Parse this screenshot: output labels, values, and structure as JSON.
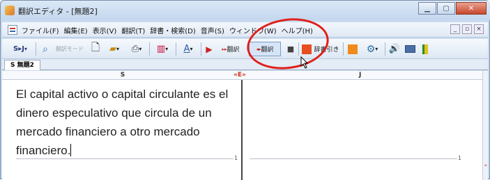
{
  "window": {
    "title": "翻訳エディタ - [無題2]",
    "controls": [
      "minimize-icon",
      "maximize-icon",
      "close-icon"
    ]
  },
  "menubar": {
    "items": [
      "ファイル(F)",
      "編集(E)",
      "表示(V)",
      "翻訳(T)",
      "辞書・検索(D)",
      "音声(S)",
      "ウィンドウ(W)",
      "ヘルプ(H)"
    ],
    "mdi_controls": [
      "_",
      "▫",
      "×"
    ]
  },
  "toolbar": {
    "lang_selector": "S▸J",
    "search_mode": "翻訳モード",
    "translate_label": "翻訳",
    "translate_back_label": "翻訳",
    "dict_lookup_label": "辞書引き"
  },
  "tab": {
    "label": "S 無題2"
  },
  "editor": {
    "left_header": "S",
    "mid_marker": "«E»",
    "right_header": "J",
    "source_text": "El capital activo o capital circulante es el dinero especulativo que circula de un mercado financiero a otro mercado financiero.",
    "left_page_num": "1",
    "right_page_num": "1",
    "gutter_marker": "«"
  }
}
